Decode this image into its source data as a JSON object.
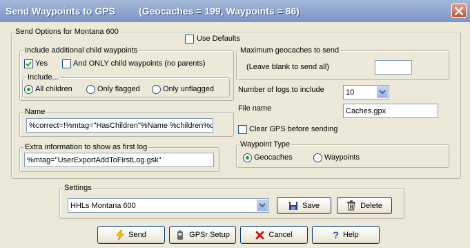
{
  "window": {
    "title": "Send Waypoints to GPS",
    "counts": "(Geocaches = 199, Waypoints = 86)"
  },
  "send_options": {
    "group_label": "Send Options for Montana 600",
    "use_defaults": {
      "label": "Use Defaults",
      "checked": false
    }
  },
  "child_waypoints": {
    "group_label": "Include additional child waypoints",
    "yes": {
      "label": "Yes",
      "checked": true
    },
    "only_child": {
      "label": "And ONLY child waypoints (no parents)",
      "checked": false
    },
    "include": {
      "group_label": "Include...",
      "options": [
        {
          "label": "All children",
          "selected": true
        },
        {
          "label": "Only flagged",
          "selected": false
        },
        {
          "label": "Only unflagged",
          "selected": false
        }
      ]
    }
  },
  "max_geocaches": {
    "group_label": "Maximum geocaches to send",
    "hint": "(Leave blank to send all)",
    "value": ""
  },
  "logs": {
    "label": "Number of logs to include",
    "value": "10"
  },
  "file": {
    "label": "File name",
    "value": "Caches.gpx"
  },
  "clear_gps": {
    "label": "Clear GPS before sending",
    "checked": false
  },
  "waypoint_type": {
    "group_label": "Waypoint Type",
    "options": [
      {
        "label": "Geocaches",
        "selected": true
      },
      {
        "label": "Waypoints",
        "selected": false
      }
    ]
  },
  "name": {
    "group_label": "Name",
    "value": "%correct=!%mtag=\"HasChildren\"%Name %children%c_"
  },
  "extra_info": {
    "group_label": "Extra information to show as first log",
    "value": "%mtag=\"UserExportAddToFirstLog.gsk\""
  },
  "settings": {
    "group_label": "Settings",
    "value": "HHLs Montana 600",
    "save_label": "Save",
    "delete_label": "Delete"
  },
  "buttons": {
    "send": "Send",
    "gpsr_setup": "GPSr Setup",
    "cancel": "Cancel",
    "help": "Help"
  },
  "icons": {
    "close": "close-icon",
    "save": "floppy-disk-icon",
    "delete": "trash-can-icon",
    "send": "lightning-icon",
    "gpsr_setup": "gps-device-icon",
    "cancel": "red-x-icon",
    "help": "question-mark-icon"
  }
}
